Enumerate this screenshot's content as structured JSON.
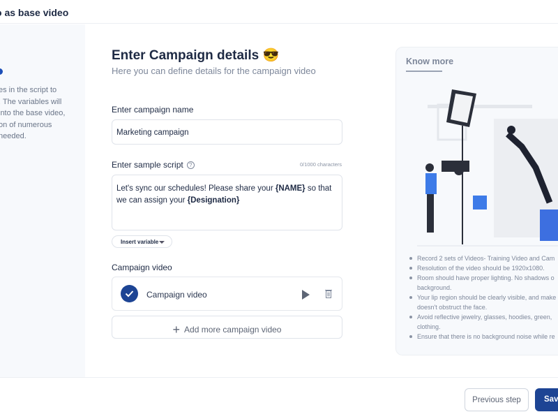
{
  "header": {
    "title": "o as base video"
  },
  "left": {
    "text_lines": [
      "es in the script to",
      ". The variables will",
      " into the base video,",
      "on of numerous",
      " needed."
    ]
  },
  "main": {
    "title": "Enter Campaign details",
    "title_emoji": "😎",
    "subtitle": "Here you can define details for the campaign video",
    "campaign_name": {
      "label": "Enter campaign name",
      "value": "Marketing campaign"
    },
    "script": {
      "label": "Enter sample script",
      "help_icon": "question-circle-icon",
      "counter": "0/1000 characters",
      "parts": [
        {
          "text": "Let's sync our schedules! Please share your ",
          "bold": false
        },
        {
          "text": "{NAME}",
          "bold": true
        },
        {
          "text": " so that we can assign your ",
          "bold": false
        },
        {
          "text": "{Designation}",
          "bold": true
        }
      ]
    },
    "insert_variable": "Insert variable",
    "campaign_video": {
      "label": "Campaign video",
      "item_name": "Campaign video",
      "add_label": "Add more campaign video"
    }
  },
  "know_more": {
    "title": "Know more",
    "tips": [
      "Record 2 sets of Videos- Training Video and Cam",
      "Resolution of the video should be 1920x1080.",
      "Room should have proper lighting. No shadows o",
      "background.",
      "Your lip region should be clearly visible, and make",
      "doesn't obstruct the face.",
      "Avoid reflective jewelry, glasses, hoodies, green,",
      "clothing.",
      "Ensure that there is no background noise while re"
    ]
  },
  "footer": {
    "previous": "Previous step",
    "save": "Save"
  },
  "colors": {
    "primary": "#1d4494",
    "panel": "#f7f9fc"
  }
}
